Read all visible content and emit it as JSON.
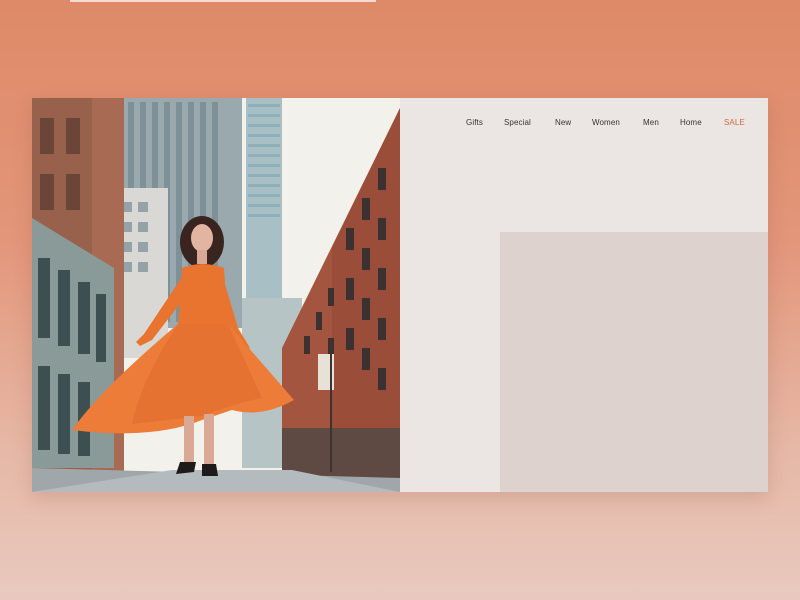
{
  "nav": {
    "items": [
      {
        "label": "Gifts"
      },
      {
        "label": "Special"
      },
      {
        "label": "New"
      },
      {
        "label": "Women"
      },
      {
        "label": "Men"
      },
      {
        "label": "Home"
      },
      {
        "label": "SALE"
      }
    ]
  },
  "colors": {
    "background_top": "#de8a68",
    "background_bottom": "#e9c9bf",
    "card": "#ebe6e3",
    "panel": "#ddd2ce",
    "accent_sale": "#c86b45",
    "dress": "#e8742f"
  },
  "hero_image": {
    "subject": "woman in orange lace dress on city street"
  }
}
